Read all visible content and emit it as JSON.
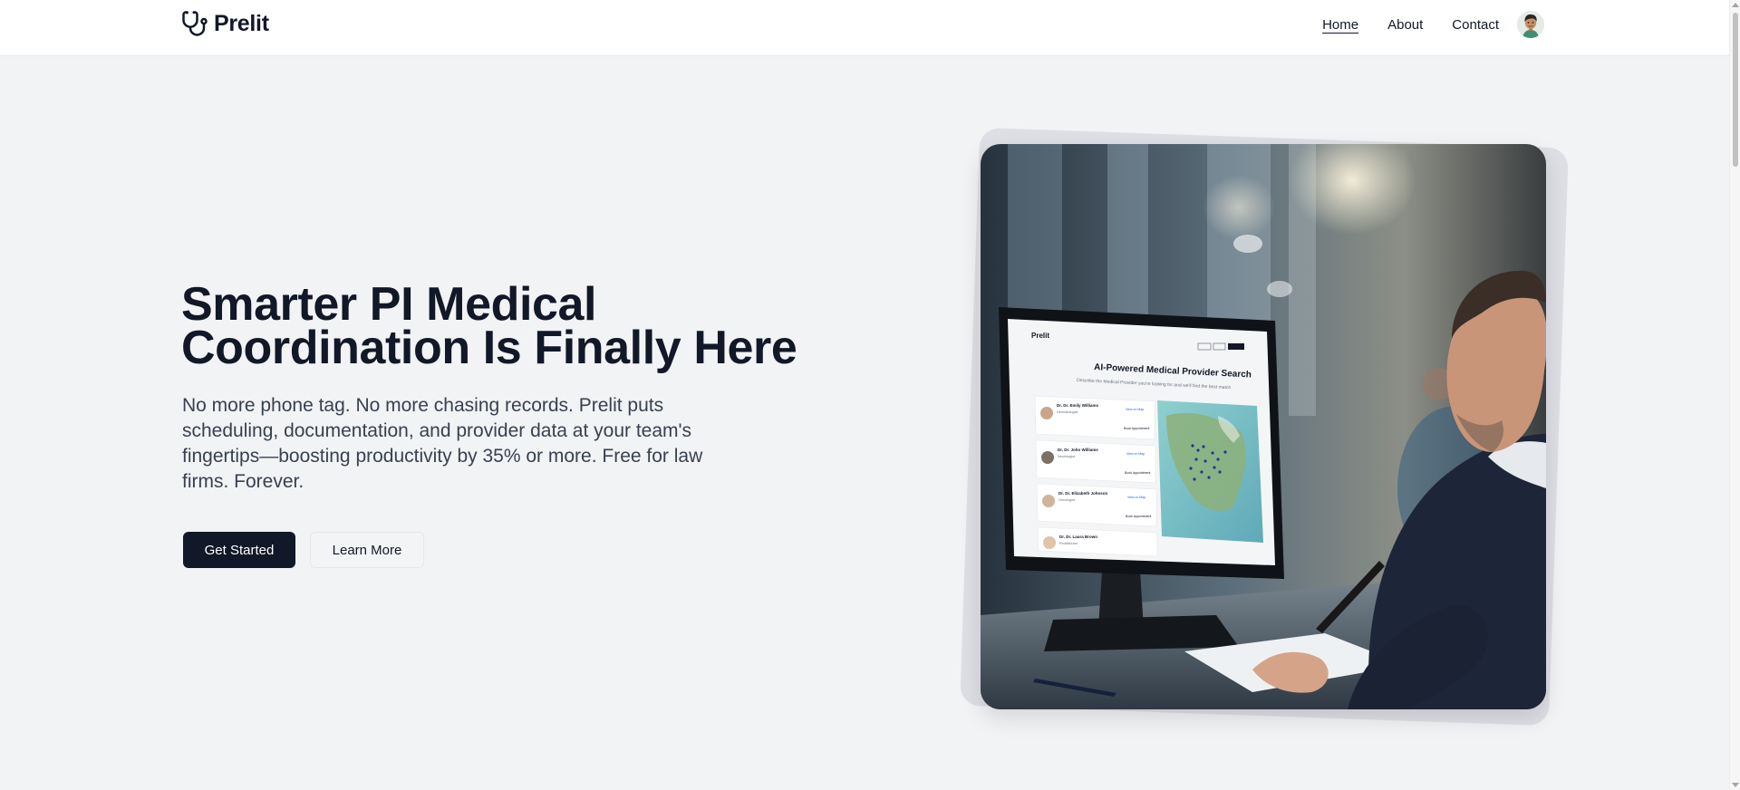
{
  "header": {
    "brand_name": "Prelit",
    "nav": [
      {
        "label": "Home",
        "active": true
      },
      {
        "label": "About",
        "active": false
      },
      {
        "label": "Contact",
        "active": false
      }
    ]
  },
  "hero": {
    "headline_line1": "Smarter PI Medical",
    "headline_line2": "Coordination Is Finally Here",
    "subtext": "No more phone tag. No more chasing records. Prelit puts scheduling, documentation, and provider data at your team's fingertips—boosting productivity by 35% or more. Free for law firms. Forever.",
    "primary_button": "Get Started",
    "secondary_button": "Learn More"
  },
  "screen_mockup": {
    "brand": "Prelit",
    "title": "AI-Powered Medical Provider Search",
    "subtitle": "Describe the Medical Provider you're looking for and we'll find the best match",
    "providers": [
      {
        "name": "Dr. Dr. Emily Williams",
        "specialty": "Dermatologist"
      },
      {
        "name": "Dr. Dr. John Williams",
        "specialty": "Neurologist"
      },
      {
        "name": "Dr. Dr. Elizabeth Johnson",
        "specialty": "Oncologist"
      },
      {
        "name": "Dr. Dr. Laura Brown",
        "specialty": "Pediatrician"
      }
    ],
    "view_on_map": "View on Map",
    "book": "Book Appointment"
  },
  "colors": {
    "primary": "#111827",
    "background": "#f2f3f5",
    "text_muted": "#374151"
  }
}
